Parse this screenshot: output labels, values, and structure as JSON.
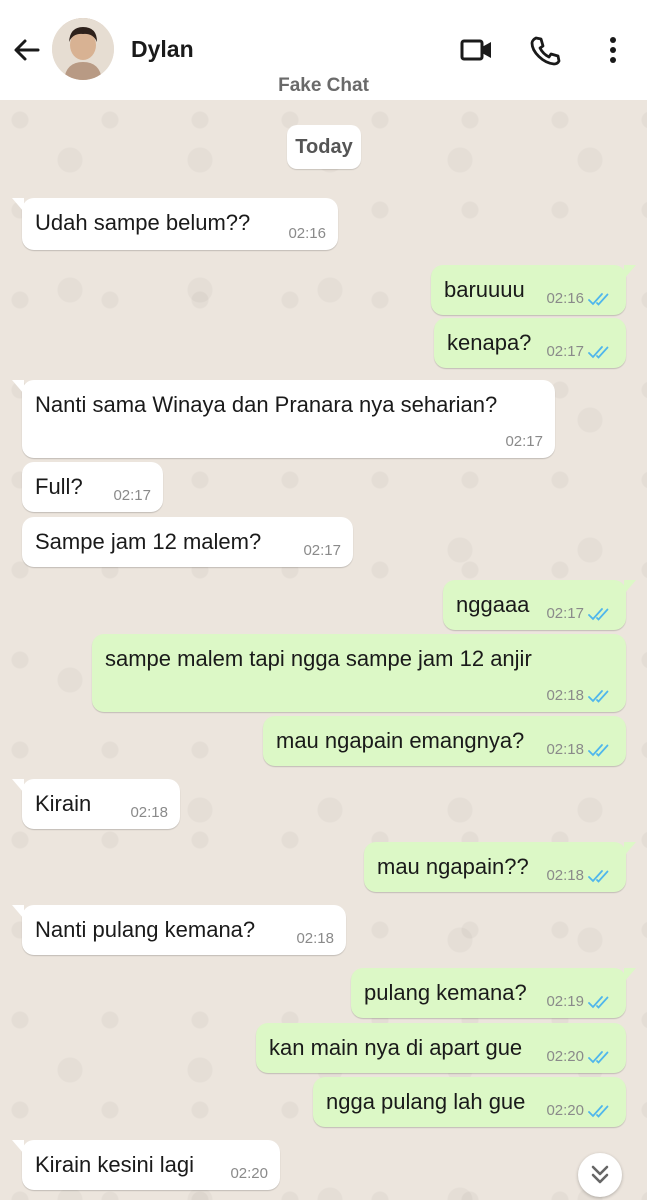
{
  "header": {
    "contact_name": "Dylan",
    "subtitle": "Fake Chat"
  },
  "date_separator": "Today",
  "colors": {
    "incoming_bubble": "#ffffff",
    "outgoing_bubble": "#dcf8c6",
    "read_ticks": "#4fb6ec",
    "chat_background": "#ece5dd"
  },
  "messages": [
    {
      "dir": "in",
      "text": "Udah sampe belum??",
      "time": "02:16"
    },
    {
      "dir": "out",
      "text": "baruuuu",
      "time": "02:16",
      "status": "read"
    },
    {
      "dir": "out",
      "text": "kenapa?",
      "time": "02:17",
      "status": "read"
    },
    {
      "dir": "in",
      "text": "Nanti sama Winaya dan Pranara nya seharian?",
      "time": "02:17"
    },
    {
      "dir": "in",
      "text": "Full?",
      "time": "02:17"
    },
    {
      "dir": "in",
      "text": "Sampe jam 12 malem?",
      "time": "02:17"
    },
    {
      "dir": "out",
      "text": "nggaaa",
      "time": "02:17",
      "status": "read"
    },
    {
      "dir": "out",
      "text": "sampe malem tapi ngga sampe jam 12 anjir",
      "time": "02:18",
      "status": "read"
    },
    {
      "dir": "out",
      "text": "mau ngapain emangnya?",
      "time": "02:18",
      "status": "read"
    },
    {
      "dir": "in",
      "text": "Kirain",
      "time": "02:18"
    },
    {
      "dir": "out",
      "text": "mau ngapain??",
      "time": "02:18",
      "status": "read"
    },
    {
      "dir": "in",
      "text": "Nanti pulang kemana?",
      "time": "02:18"
    },
    {
      "dir": "out",
      "text": "pulang kemana?",
      "time": "02:19",
      "status": "read"
    },
    {
      "dir": "out",
      "text": "kan main nya di apart gue",
      "time": "02:20",
      "status": "read"
    },
    {
      "dir": "out",
      "text": "ngga pulang lah gue",
      "time": "02:20",
      "status": "read"
    },
    {
      "dir": "in",
      "text": "Kirain kesini lagi",
      "time": "02:20"
    }
  ],
  "icons": {
    "back": "arrow-left",
    "video": "video-camera",
    "call": "phone",
    "menu": "three-dots-vertical",
    "scroll": "double-chevron-down"
  }
}
